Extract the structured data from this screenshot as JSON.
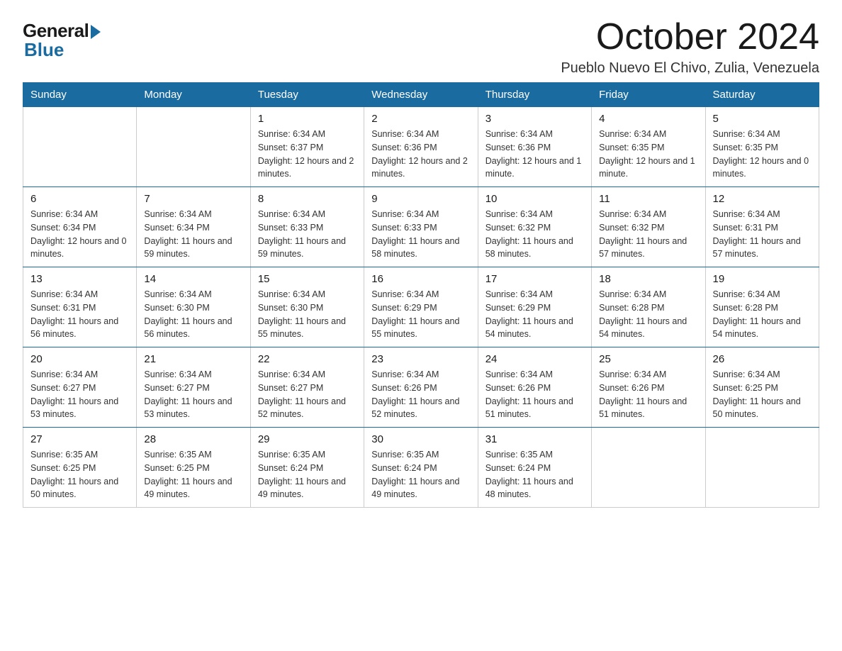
{
  "logo": {
    "general": "General",
    "blue": "Blue"
  },
  "header": {
    "month": "October 2024",
    "location": "Pueblo Nuevo El Chivo, Zulia, Venezuela"
  },
  "weekdays": [
    "Sunday",
    "Monday",
    "Tuesday",
    "Wednesday",
    "Thursday",
    "Friday",
    "Saturday"
  ],
  "weeks": [
    [
      {
        "day": "",
        "sunrise": "",
        "sunset": "",
        "daylight": ""
      },
      {
        "day": "",
        "sunrise": "",
        "sunset": "",
        "daylight": ""
      },
      {
        "day": "1",
        "sunrise": "Sunrise: 6:34 AM",
        "sunset": "Sunset: 6:37 PM",
        "daylight": "Daylight: 12 hours and 2 minutes."
      },
      {
        "day": "2",
        "sunrise": "Sunrise: 6:34 AM",
        "sunset": "Sunset: 6:36 PM",
        "daylight": "Daylight: 12 hours and 2 minutes."
      },
      {
        "day": "3",
        "sunrise": "Sunrise: 6:34 AM",
        "sunset": "Sunset: 6:36 PM",
        "daylight": "Daylight: 12 hours and 1 minute."
      },
      {
        "day": "4",
        "sunrise": "Sunrise: 6:34 AM",
        "sunset": "Sunset: 6:35 PM",
        "daylight": "Daylight: 12 hours and 1 minute."
      },
      {
        "day": "5",
        "sunrise": "Sunrise: 6:34 AM",
        "sunset": "Sunset: 6:35 PM",
        "daylight": "Daylight: 12 hours and 0 minutes."
      }
    ],
    [
      {
        "day": "6",
        "sunrise": "Sunrise: 6:34 AM",
        "sunset": "Sunset: 6:34 PM",
        "daylight": "Daylight: 12 hours and 0 minutes."
      },
      {
        "day": "7",
        "sunrise": "Sunrise: 6:34 AM",
        "sunset": "Sunset: 6:34 PM",
        "daylight": "Daylight: 11 hours and 59 minutes."
      },
      {
        "day": "8",
        "sunrise": "Sunrise: 6:34 AM",
        "sunset": "Sunset: 6:33 PM",
        "daylight": "Daylight: 11 hours and 59 minutes."
      },
      {
        "day": "9",
        "sunrise": "Sunrise: 6:34 AM",
        "sunset": "Sunset: 6:33 PM",
        "daylight": "Daylight: 11 hours and 58 minutes."
      },
      {
        "day": "10",
        "sunrise": "Sunrise: 6:34 AM",
        "sunset": "Sunset: 6:32 PM",
        "daylight": "Daylight: 11 hours and 58 minutes."
      },
      {
        "day": "11",
        "sunrise": "Sunrise: 6:34 AM",
        "sunset": "Sunset: 6:32 PM",
        "daylight": "Daylight: 11 hours and 57 minutes."
      },
      {
        "day": "12",
        "sunrise": "Sunrise: 6:34 AM",
        "sunset": "Sunset: 6:31 PM",
        "daylight": "Daylight: 11 hours and 57 minutes."
      }
    ],
    [
      {
        "day": "13",
        "sunrise": "Sunrise: 6:34 AM",
        "sunset": "Sunset: 6:31 PM",
        "daylight": "Daylight: 11 hours and 56 minutes."
      },
      {
        "day": "14",
        "sunrise": "Sunrise: 6:34 AM",
        "sunset": "Sunset: 6:30 PM",
        "daylight": "Daylight: 11 hours and 56 minutes."
      },
      {
        "day": "15",
        "sunrise": "Sunrise: 6:34 AM",
        "sunset": "Sunset: 6:30 PM",
        "daylight": "Daylight: 11 hours and 55 minutes."
      },
      {
        "day": "16",
        "sunrise": "Sunrise: 6:34 AM",
        "sunset": "Sunset: 6:29 PM",
        "daylight": "Daylight: 11 hours and 55 minutes."
      },
      {
        "day": "17",
        "sunrise": "Sunrise: 6:34 AM",
        "sunset": "Sunset: 6:29 PM",
        "daylight": "Daylight: 11 hours and 54 minutes."
      },
      {
        "day": "18",
        "sunrise": "Sunrise: 6:34 AM",
        "sunset": "Sunset: 6:28 PM",
        "daylight": "Daylight: 11 hours and 54 minutes."
      },
      {
        "day": "19",
        "sunrise": "Sunrise: 6:34 AM",
        "sunset": "Sunset: 6:28 PM",
        "daylight": "Daylight: 11 hours and 54 minutes."
      }
    ],
    [
      {
        "day": "20",
        "sunrise": "Sunrise: 6:34 AM",
        "sunset": "Sunset: 6:27 PM",
        "daylight": "Daylight: 11 hours and 53 minutes."
      },
      {
        "day": "21",
        "sunrise": "Sunrise: 6:34 AM",
        "sunset": "Sunset: 6:27 PM",
        "daylight": "Daylight: 11 hours and 53 minutes."
      },
      {
        "day": "22",
        "sunrise": "Sunrise: 6:34 AM",
        "sunset": "Sunset: 6:27 PM",
        "daylight": "Daylight: 11 hours and 52 minutes."
      },
      {
        "day": "23",
        "sunrise": "Sunrise: 6:34 AM",
        "sunset": "Sunset: 6:26 PM",
        "daylight": "Daylight: 11 hours and 52 minutes."
      },
      {
        "day": "24",
        "sunrise": "Sunrise: 6:34 AM",
        "sunset": "Sunset: 6:26 PM",
        "daylight": "Daylight: 11 hours and 51 minutes."
      },
      {
        "day": "25",
        "sunrise": "Sunrise: 6:34 AM",
        "sunset": "Sunset: 6:26 PM",
        "daylight": "Daylight: 11 hours and 51 minutes."
      },
      {
        "day": "26",
        "sunrise": "Sunrise: 6:34 AM",
        "sunset": "Sunset: 6:25 PM",
        "daylight": "Daylight: 11 hours and 50 minutes."
      }
    ],
    [
      {
        "day": "27",
        "sunrise": "Sunrise: 6:35 AM",
        "sunset": "Sunset: 6:25 PM",
        "daylight": "Daylight: 11 hours and 50 minutes."
      },
      {
        "day": "28",
        "sunrise": "Sunrise: 6:35 AM",
        "sunset": "Sunset: 6:25 PM",
        "daylight": "Daylight: 11 hours and 49 minutes."
      },
      {
        "day": "29",
        "sunrise": "Sunrise: 6:35 AM",
        "sunset": "Sunset: 6:24 PM",
        "daylight": "Daylight: 11 hours and 49 minutes."
      },
      {
        "day": "30",
        "sunrise": "Sunrise: 6:35 AM",
        "sunset": "Sunset: 6:24 PM",
        "daylight": "Daylight: 11 hours and 49 minutes."
      },
      {
        "day": "31",
        "sunrise": "Sunrise: 6:35 AM",
        "sunset": "Sunset: 6:24 PM",
        "daylight": "Daylight: 11 hours and 48 minutes."
      },
      {
        "day": "",
        "sunrise": "",
        "sunset": "",
        "daylight": ""
      },
      {
        "day": "",
        "sunrise": "",
        "sunset": "",
        "daylight": ""
      }
    ]
  ]
}
